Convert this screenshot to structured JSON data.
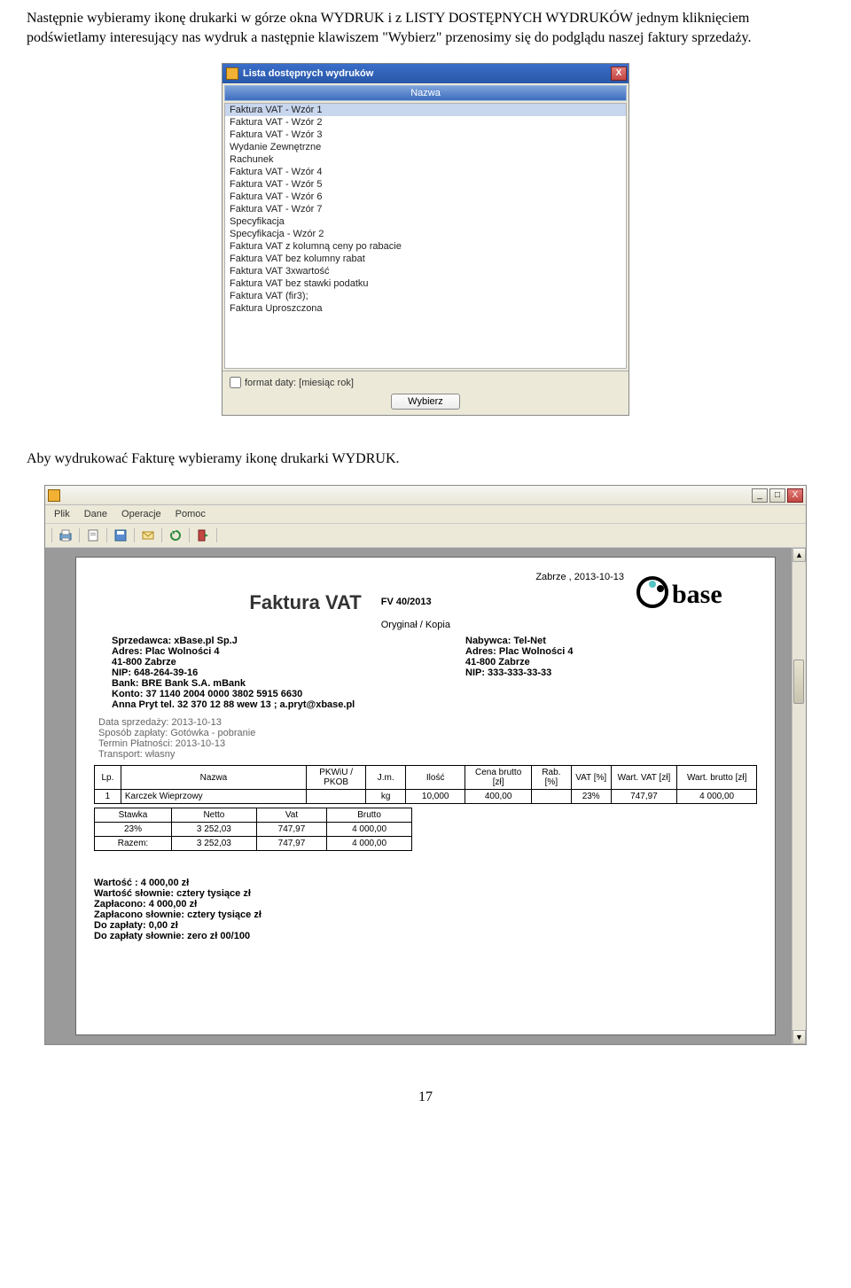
{
  "intro": "Następnie wybieramy ikonę drukarki w górze okna WYDRUK i z LISTY DOSTĘPNYCH WYDRUKÓW jednym kliknięciem podświetlamy interesujący nas wydruk a następnie klawiszem \"Wybierz\" przenosimy się do podglądu naszej faktury sprzedaży.",
  "dialog": {
    "title": "Lista dostępnych wydruków",
    "close": "X",
    "column_header": "Nazwa",
    "items": [
      "Faktura VAT - Wzór 1",
      "Faktura VAT - Wzór 2",
      "Faktura VAT - Wzór 3",
      "Wydanie Zewnętrzne",
      "Rachunek",
      "Faktura VAT - Wzór 4",
      "Faktura VAT - Wzór 5",
      "Faktura VAT - Wzór 6",
      "Faktura VAT - Wzór 7",
      "Specyfikacja",
      "Specyfikacja - Wzór 2",
      "Faktura VAT z kolumną ceny po rabacie",
      "Faktura VAT bez kolumny rabat",
      "Faktura VAT 3xwartość",
      "Faktura VAT bez stawki podatku",
      "Faktura VAT (fir3);",
      "Faktura Uproszczona"
    ],
    "checkbox_label": "format daty: [miesiąc rok]",
    "button": "Wybierz"
  },
  "mid_text": "Aby wydrukować Fakturę wybieramy ikonę  drukarki WYDRUK.",
  "appwin": {
    "menu": [
      "Plik",
      "Dane",
      "Operacje",
      "Pomoc"
    ],
    "minimize": "_",
    "maximize": "□",
    "close": "X",
    "scroll_up": "▲",
    "scroll_down": "▼"
  },
  "invoice": {
    "place_date": "Zabrze , 2013-10-13",
    "title": "Faktura VAT",
    "number": "FV 40/2013",
    "orig_copy": "Oryginał  /  Kopia",
    "logo_text": "base",
    "seller": {
      "name": "Sprzedawca: xBase.pl Sp.J",
      "addr1": "Adres: Plac Wolności 4",
      "addr2": "41-800 Zabrze",
      "nip": "NIP: 648-264-39-16",
      "bank": "Bank: BRE Bank S.A. mBank",
      "konto": "Konto: 37 1140 2004 0000 3802 5915 6630",
      "contact": "Anna Pryt tel. 32 370 12 88 wew 13 ;  a.pryt@xbase.pl"
    },
    "buyer": {
      "name": "Nabywca: Tel-Net",
      "addr1": "Adres: Plac Wolności 4",
      "addr2": "41-800 Zabrze",
      "nip": "NIP: 333-333-33-33"
    },
    "meta": {
      "data_sprz": "Data sprzedaży: 2013-10-13",
      "sposob": "Sposób zapłaty: Gotówka - pobranie",
      "termin": "Termin Płatności: 2013-10-13",
      "transport": "Transport: własny"
    },
    "items_header": [
      "Lp.",
      "Nazwa",
      "PKWiU / PKOB",
      "J.m.",
      "Ilość",
      "Cena brutto [zł]",
      "Rab. [%]",
      "VAT [%]",
      "Wart. VAT [zł]",
      "Wart. brutto [zł]"
    ],
    "items": [
      {
        "lp": "1",
        "nazwa": "Karczek Wieprzowy",
        "pkwiu": "",
        "jm": "kg",
        "ilosc": "10,000",
        "cena": "400,00",
        "rab": "",
        "vat": "23%",
        "wvat": "747,97",
        "wbrutto": "4 000,00"
      }
    ],
    "sum_header": [
      "Stawka",
      "Netto",
      "Vat",
      "Brutto"
    ],
    "sum_rows": [
      {
        "stawka": "23%",
        "netto": "3 252,03",
        "vat": "747,97",
        "brutto": "4 000,00"
      },
      {
        "stawka": "Razem:",
        "netto": "3 252,03",
        "vat": "747,97",
        "brutto": "4 000,00"
      }
    ],
    "totals": {
      "wartosc": "Wartość : 4 000,00 zł",
      "wartosc_sl": "Wartość słownie:  cztery tysiące zł",
      "zaplacono": "Zapłacono: 4 000,00 zł",
      "zaplacono_sl": "Zapłacono słownie:  cztery tysiące zł",
      "do_zaplaty": "Do zapłaty: 0,00 zł",
      "do_zaplaty_sl": "Do zapłaty słownie: zero zł  00/100"
    }
  },
  "page_number": "17"
}
